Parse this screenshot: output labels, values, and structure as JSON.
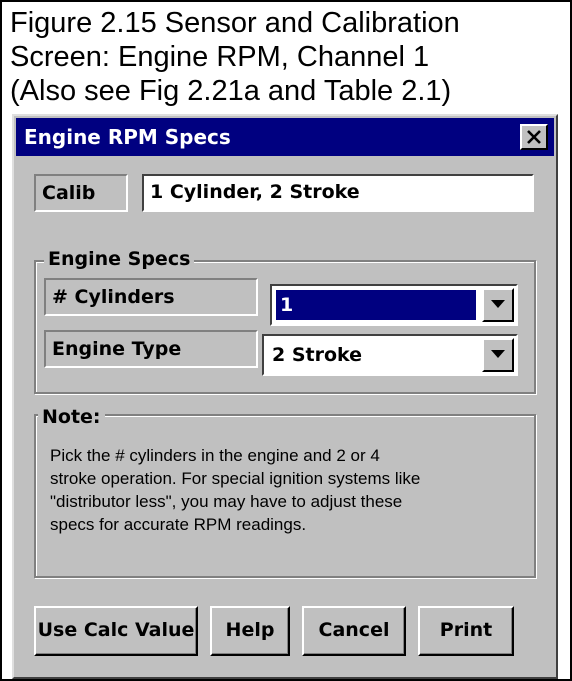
{
  "caption": {
    "line1": "Figure 2.15  Sensor and Calibration",
    "line2": "Screen:  Engine RPM, Channel 1",
    "line3": "(Also see Fig 2.21a and Table 2.1)"
  },
  "dialog": {
    "title": "Engine RPM Specs",
    "close_icon": "close-icon"
  },
  "calib": {
    "label": "Calib",
    "value": "1 Cylinder,  2 Stroke"
  },
  "engine_specs": {
    "group_title": "Engine Specs",
    "cylinders_label": "# Cylinders",
    "cylinders_value": "1",
    "engine_type_label": "Engine Type",
    "engine_type_value": "2 Stroke"
  },
  "note": {
    "title": "Note:",
    "lines": [
      "Pick the # cylinders in the engine and 2 or 4",
      "stroke operation.  For special ignition systems like",
      "\"distributor less\", you may have to adjust these",
      "specs for accurate RPM readings."
    ]
  },
  "buttons": {
    "use_calc": "Use Calc Value",
    "help": "Help",
    "cancel": "Cancel",
    "print": "Print"
  },
  "colors": {
    "titlebar": "#000080",
    "dialog_face": "#c0c0c0",
    "selection": "#000080"
  }
}
